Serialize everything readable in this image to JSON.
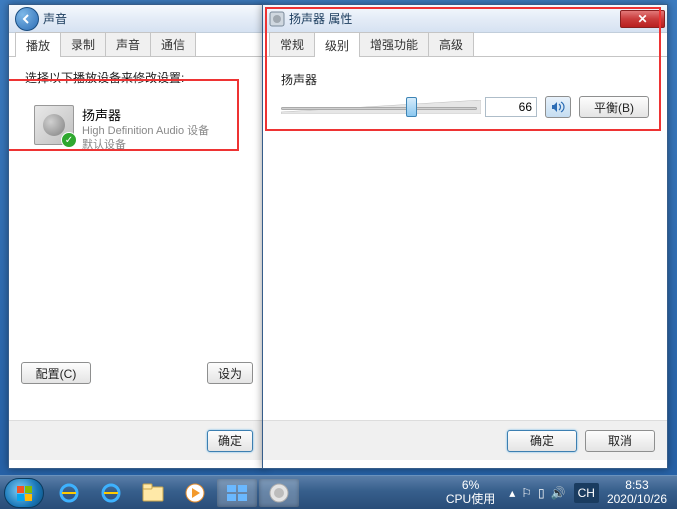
{
  "sound_window": {
    "title": "声音",
    "tabs": [
      "播放",
      "录制",
      "声音",
      "通信"
    ],
    "active_tab": 0,
    "instruction": "选择以下播放设备来修改设置:",
    "device": {
      "name": "扬声器",
      "driver": "High Definition Audio 设备",
      "status": "默认设备"
    },
    "configure_btn": "配置(C)",
    "set_default_btn": "设为",
    "ok_btn": "确定"
  },
  "props_window": {
    "title": "扬声器 属性",
    "tabs": [
      "常规",
      "级别",
      "增强功能",
      "高级"
    ],
    "active_tab": 1,
    "group_label": "扬声器",
    "volume_value": "66",
    "balance_btn": "平衡(B)",
    "ok_btn": "确定",
    "cancel_btn": "取消"
  },
  "taskbar": {
    "lang": "CH",
    "cpu_pct": "6%",
    "cpu_label": "CPU使用",
    "time": "8:53",
    "date": "2020/10/26"
  },
  "colors": {
    "highlight": "#ee3333"
  }
}
